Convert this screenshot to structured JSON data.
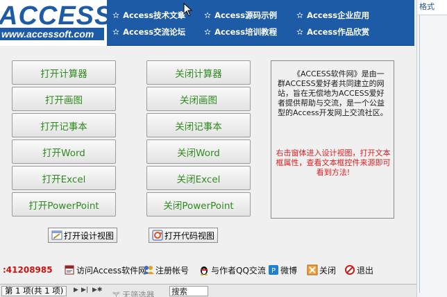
{
  "banner": {
    "logo": "ACCESS",
    "logo_url": "www.accessoft.com",
    "nav": [
      {
        "label": "Access技术文章"
      },
      {
        "label": "Access源码示例"
      },
      {
        "label": "Access企业应用"
      },
      {
        "label": "Access交流论坛"
      },
      {
        "label": "Access培训教程"
      },
      {
        "label": "Access作品欣赏"
      }
    ],
    "star": "✫"
  },
  "right_panel": {
    "label": "格式"
  },
  "buttons": {
    "open_calc": "打开计算器",
    "close_calc": "关闭计算器",
    "open_paint": "打开画图",
    "close_paint": "关闭画图",
    "open_notepad": "打开记事本",
    "close_notepad": "关闭记事本",
    "open_word": "打开Word",
    "close_word": "关闭Word",
    "open_excel": "打开Excel",
    "close_excel": "关闭Excel",
    "open_ppt": "打开PowerPoint",
    "close_ppt": "关闭PowerPoint"
  },
  "info": {
    "text": "《ACCESS软件网》是由一群ACCESS爱好者共同建立的网站，旨在无偿地为ACCESS爱好者提供帮助与交流，是一个公益型的Access开发网上交流社区。",
    "hint": "右击窗体进入设计视图，打开文本框属性，查看文本框控件来源即可看到方法!"
  },
  "view_buttons": {
    "design": "打开设计视图",
    "code": "打开代码视图"
  },
  "footer": {
    "qq": ":41208985",
    "visit": "访问Access软件网",
    "register": "注册帐号",
    "qq_chat": "与作者QQ交流",
    "weibo": "微博",
    "close": "关闭",
    "exit": "退出"
  },
  "statusbar": {
    "record": "第 1 项(共 1 项)",
    "filter": "无筛选器",
    "search": "搜索"
  }
}
